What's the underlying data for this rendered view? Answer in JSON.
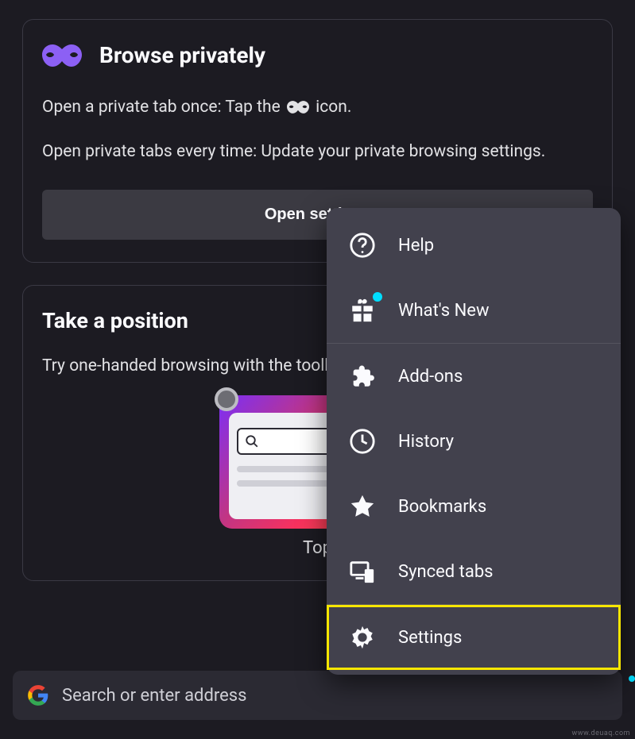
{
  "privateCard": {
    "title": "Browse privately",
    "line1_prefix": "Open a private tab once: Tap the ",
    "line1_suffix": " icon.",
    "line2": "Open private tabs every time: Update your private browsing settings.",
    "button": "Open settings"
  },
  "positionCard": {
    "title": "Take a position",
    "body": "Try one-handed browsing with the toolbar on bottom or move it to the top.",
    "option_label": "Top"
  },
  "addressBar": {
    "placeholder": "Search or enter address"
  },
  "menu": {
    "items": [
      {
        "id": "help",
        "label": "Help",
        "icon": "help-circle-icon"
      },
      {
        "id": "whatsnew",
        "label": "What's New",
        "icon": "gift-icon",
        "notification": true
      },
      {
        "id": "addons",
        "label": "Add-ons",
        "icon": "puzzle-icon"
      },
      {
        "id": "history",
        "label": "History",
        "icon": "clock-icon"
      },
      {
        "id": "bookmarks",
        "label": "Bookmarks",
        "icon": "star-icon"
      },
      {
        "id": "syncedtabs",
        "label": "Synced tabs",
        "icon": "synced-tabs-icon"
      },
      {
        "id": "settings",
        "label": "Settings",
        "icon": "gear-icon",
        "highlighted": true
      }
    ]
  },
  "watermark": "www.deuaq.com"
}
